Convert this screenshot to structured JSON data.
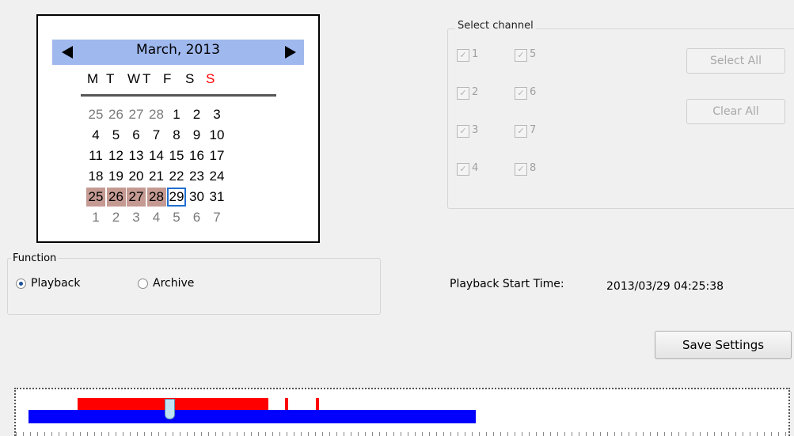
{
  "calendar": {
    "title": "March, 2013",
    "weekdays": [
      {
        "label": "M",
        "color": "#000000"
      },
      {
        "label": "T",
        "color": "#000000"
      },
      {
        "label": "W",
        "color": "#000000"
      },
      {
        "label": "T",
        "color": "#000000"
      },
      {
        "label": "F",
        "color": "#000000"
      },
      {
        "label": "S",
        "color": "#000000"
      },
      {
        "label": "S",
        "color": "#ff0000"
      }
    ],
    "weeks": [
      [
        {
          "d": "25",
          "other": true
        },
        {
          "d": "26",
          "other": true
        },
        {
          "d": "27",
          "other": true
        },
        {
          "d": "28",
          "other": true
        },
        {
          "d": "1"
        },
        {
          "d": "2"
        },
        {
          "d": "3"
        }
      ],
      [
        {
          "d": "4"
        },
        {
          "d": "5"
        },
        {
          "d": "6"
        },
        {
          "d": "7"
        },
        {
          "d": "8"
        },
        {
          "d": "9"
        },
        {
          "d": "10"
        }
      ],
      [
        {
          "d": "11"
        },
        {
          "d": "12"
        },
        {
          "d": "13"
        },
        {
          "d": "14"
        },
        {
          "d": "15"
        },
        {
          "d": "16"
        },
        {
          "d": "17"
        }
      ],
      [
        {
          "d": "18"
        },
        {
          "d": "19"
        },
        {
          "d": "20"
        },
        {
          "d": "21"
        },
        {
          "d": "22"
        },
        {
          "d": "23"
        },
        {
          "d": "24"
        }
      ],
      [
        {
          "d": "25",
          "rec": true
        },
        {
          "d": "26",
          "rec": true
        },
        {
          "d": "27",
          "rec": true
        },
        {
          "d": "28",
          "rec": true
        },
        {
          "d": "29",
          "selected": true
        },
        {
          "d": "30"
        },
        {
          "d": "31"
        }
      ],
      [
        {
          "d": "1",
          "other": true
        },
        {
          "d": "2",
          "other": true
        },
        {
          "d": "3",
          "other": true
        },
        {
          "d": "4",
          "other": true
        },
        {
          "d": "5",
          "other": true
        },
        {
          "d": "6",
          "other": true
        },
        {
          "d": "7",
          "other": true
        }
      ]
    ]
  },
  "channels": {
    "legend": "Select channel",
    "items": [
      {
        "label": "1",
        "checked": true,
        "enabled": false
      },
      {
        "label": "2",
        "checked": true,
        "enabled": false
      },
      {
        "label": "3",
        "checked": true,
        "enabled": false
      },
      {
        "label": "4",
        "checked": true,
        "enabled": false
      },
      {
        "label": "5",
        "checked": true,
        "enabled": false
      },
      {
        "label": "6",
        "checked": true,
        "enabled": false
      },
      {
        "label": "7",
        "checked": true,
        "enabled": false
      },
      {
        "label": "8",
        "checked": true,
        "enabled": false
      }
    ],
    "select_all_label": "Select All",
    "clear_all_label": "Clear All"
  },
  "function": {
    "legend": "Function",
    "options": [
      {
        "label": "Playback",
        "selected": true
      },
      {
        "label": "Archive",
        "selected": false
      }
    ]
  },
  "playback": {
    "label": "Playback Start Time:",
    "value": "2013/03/29 04:25:38"
  },
  "save_label": "Save Settings",
  "colors": {
    "calendar_header": "#9fb8ee",
    "recorded_day": "#c49a93",
    "selected_border": "#1f6fd0",
    "timeline_record": "#ff0000",
    "timeline_range": "#0000ff"
  }
}
